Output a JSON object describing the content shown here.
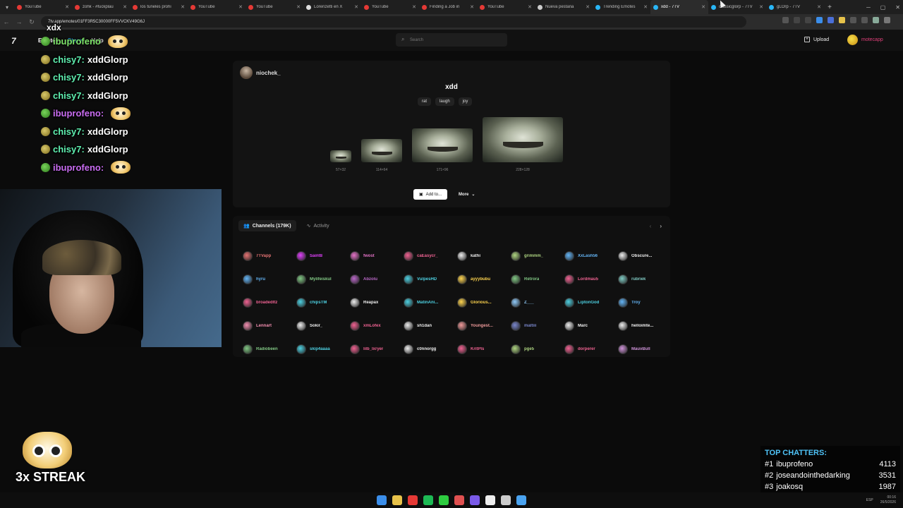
{
  "browser": {
    "tabs": [
      {
        "title": "YouTube",
        "color": "#e53935",
        "active": false
      },
      {
        "title": "zohk - #fuckplau",
        "color": "#e53935",
        "active": false
      },
      {
        "title": "los tuneles prohi",
        "color": "#e53935",
        "active": false
      },
      {
        "title": "YouTube",
        "color": "#e53935",
        "active": false
      },
      {
        "title": "YouTube",
        "color": "#e53935",
        "active": false
      },
      {
        "title": "Lorenzetti en X",
        "color": "#dddddd",
        "active": false
      },
      {
        "title": "YouTube",
        "color": "#e53935",
        "active": false
      },
      {
        "title": "Finding a Job in",
        "color": "#e53935",
        "active": false
      },
      {
        "title": "YouTube",
        "color": "#e53935",
        "active": false
      },
      {
        "title": "Nueva pestaña",
        "color": "#cccccc",
        "active": false
      },
      {
        "title": "Trending Emotes",
        "color": "#29b6f6",
        "active": false
      },
      {
        "title": "xdd - 7TV",
        "color": "#29b6f6",
        "active": true
      },
      {
        "title": "classicglorp - 7TV",
        "color": "#29b6f6",
        "active": false
      },
      {
        "title": "gLOrp - 7TV",
        "color": "#29b6f6",
        "active": false
      }
    ],
    "url": "7tv.app/emotes/01FF3R5C30000FF5VVCKV49G6J",
    "new_tab": "+",
    "min": "─",
    "max": "▢",
    "close": "✕"
  },
  "site": {
    "logo": "7",
    "nav": [
      "Emotes",
      "Store",
      "Help"
    ],
    "search_placeholder": "Search",
    "upload": "Upload",
    "username": "motecapp"
  },
  "emote": {
    "owner": "niochek_",
    "name": "xdd",
    "tags": [
      "rat",
      "laugh",
      "joy"
    ],
    "sizes": [
      "57×32",
      "114×64",
      "171×96",
      "228×128"
    ],
    "add_to": "Add to...",
    "more": "More"
  },
  "channels": {
    "tab_channels": "Channels (179K)",
    "tab_activity": "Activity",
    "list": [
      {
        "name": "7TVapp",
        "color": "#e57373"
      },
      {
        "name": "Saint8",
        "color": "#e040fb"
      },
      {
        "name": "fwost",
        "color": "#e573c8"
      },
      {
        "name": "caEasycr_",
        "color": "#f06292"
      },
      {
        "name": "kathi",
        "color": "#eeeeee"
      },
      {
        "name": "grimmm_",
        "color": "#aed581"
      },
      {
        "name": "XxLash56",
        "color": "#64b5f6"
      },
      {
        "name": "Obscure...",
        "color": "#eeeeee"
      },
      {
        "name": "hyru",
        "color": "#64b5f6"
      },
      {
        "name": "Mylifeiskul",
        "color": "#81c784"
      },
      {
        "name": "Abzolu",
        "color": "#ba68c8"
      },
      {
        "name": "VulpesHD",
        "color": "#4dd0e1"
      },
      {
        "name": "ayyybubu",
        "color": "#ffd54f"
      },
      {
        "name": "Retrora",
        "color": "#81c784"
      },
      {
        "name": "Lordmau5",
        "color": "#f06292"
      },
      {
        "name": "rubriek",
        "color": "#80cbc4"
      },
      {
        "name": "broadedltz",
        "color": "#f06292"
      },
      {
        "name": "chipsTM",
        "color": "#4dd0e1"
      },
      {
        "name": "Reapax",
        "color": "#eeeeee"
      },
      {
        "name": "MatinAni...",
        "color": "#4dd0e1"
      },
      {
        "name": "Glorious...",
        "color": "#ffd54f"
      },
      {
        "name": "Z___",
        "color": "#90caf9"
      },
      {
        "name": "LiptonGod",
        "color": "#4dd0e1"
      },
      {
        "name": "Troy",
        "color": "#64b5f6"
      },
      {
        "name": "Lennart",
        "color": "#f48fb1"
      },
      {
        "name": "Sokir_",
        "color": "#eeeeee"
      },
      {
        "name": "xmLofex",
        "color": "#f06292"
      },
      {
        "name": "sh1dan",
        "color": "#eeeeee"
      },
      {
        "name": "Youngest...",
        "color": "#ef9a9a"
      },
      {
        "name": "maltiii",
        "color": "#7986cb"
      },
      {
        "name": "Marc",
        "color": "#eeeeee"
      },
      {
        "name": "helloimte...",
        "color": "#eeeeee"
      },
      {
        "name": "Radiobeen",
        "color": "#81c784"
      },
      {
        "name": "skip4aaaa",
        "color": "#4dd0e1"
      },
      {
        "name": "lilb_lxryer",
        "color": "#f06292"
      },
      {
        "name": "c0nnorgg",
        "color": "#eeeeee"
      },
      {
        "name": "KritPls",
        "color": "#f06292"
      },
      {
        "name": "pge5",
        "color": "#aed581"
      },
      {
        "name": "dorperer",
        "color": "#f06292"
      },
      {
        "name": "MauvBull",
        "color": "#ce93d8"
      }
    ]
  },
  "chat": {
    "top_fragment": "xdx",
    "lines": [
      {
        "user": "ibuprofeno",
        "msg": "",
        "color": "#7ee36a",
        "badge": "frog",
        "cat": true
      },
      {
        "user": "chisy7:",
        "msg": "xddGlorp",
        "color": "#5ff0b0",
        "badge": "coin",
        "cat": false
      },
      {
        "user": "chisy7:",
        "msg": "xddGlorp",
        "color": "#5ff0b0",
        "badge": "coin",
        "cat": false
      },
      {
        "user": "chisy7:",
        "msg": "xddGlorp",
        "color": "#5ff0b0",
        "badge": "coin",
        "cat": false
      },
      {
        "user": "ibuprofeno:",
        "msg": "",
        "color": "#c86cf0",
        "badge": "frog",
        "cat": true
      },
      {
        "user": "chisy7:",
        "msg": "xddGlorp",
        "color": "#5ff0b0",
        "badge": "coin",
        "cat": false
      },
      {
        "user": "chisy7:",
        "msg": "xddGlorp",
        "color": "#5ff0b0",
        "badge": "coin",
        "cat": false
      },
      {
        "user": "ibuprofeno:",
        "msg": "",
        "color": "#c86cf0",
        "badge": "frog",
        "cat": true
      }
    ]
  },
  "streak": "3x STREAK",
  "top_chatters": {
    "title": "TOP CHATTERS:",
    "rows": [
      {
        "rank": "#1",
        "name": "ibuprofeno",
        "count": "4113"
      },
      {
        "rank": "#2",
        "name": "joseandointhedarking",
        "count": "3531"
      },
      {
        "rank": "#3",
        "name": "joakosq",
        "count": "1987"
      }
    ]
  },
  "taskbar": {
    "icons": [
      "#3b8eea",
      "#e8c24a",
      "#e53935",
      "#1db954",
      "#2ecc40",
      "#e05050",
      "#7a5ae8",
      "#eeeeee",
      "#cccccc",
      "#4aa3f0"
    ],
    "lang": "ESP",
    "clock_time": "00:16",
    "clock_date": "26/5/2026"
  }
}
